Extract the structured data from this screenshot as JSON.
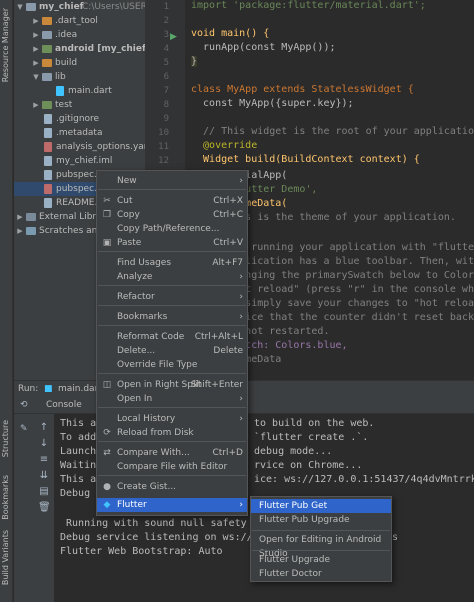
{
  "left_strip": {
    "tabs": [
      "Resource Manager",
      "Structure",
      "Bookmarks",
      "Build Variants"
    ]
  },
  "project_tree": {
    "items": [
      {
        "label": "my_chief",
        "sublabel": "C:\\Users\\USER-F",
        "kind": "folder"
      },
      {
        "label": ".dart_tool",
        "kind": "folder-orange"
      },
      {
        "label": ".idea",
        "kind": "folder"
      },
      {
        "label": "android [my_chief_andro",
        "kind": "folder-green"
      },
      {
        "label": "build",
        "kind": "folder-orange"
      },
      {
        "label": "lib",
        "kind": "folder"
      },
      {
        "label": "main.dart",
        "kind": "dart"
      },
      {
        "label": "test",
        "kind": "folder-green"
      },
      {
        "label": ".gitignore",
        "kind": "file"
      },
      {
        "label": ".metadata",
        "kind": "file"
      },
      {
        "label": "analysis_options.yaml",
        "kind": "yaml"
      },
      {
        "label": "my_chief.iml",
        "kind": "file"
      },
      {
        "label": "pubspec.lock",
        "kind": "file"
      },
      {
        "label": "pubspec.ya",
        "kind": "yaml"
      },
      {
        "label": "README.m",
        "kind": "file"
      },
      {
        "label": "External Librar",
        "kind": "lib"
      },
      {
        "label": "Scratches and",
        "kind": "scratch"
      }
    ]
  },
  "editor": {
    "line_numbers": [
      "1",
      "2",
      "3",
      "4",
      "5",
      "6",
      "7",
      "8",
      "9",
      "10",
      "11",
      "12"
    ],
    "lines": [
      {
        "n": "1",
        "text": "import 'package:flutter/material.dart';"
      },
      {
        "n": "3",
        "text": "void main() {"
      },
      {
        "n": "4",
        "text": "  runApp(const MyApp());"
      },
      {
        "n": "5",
        "text": "}"
      },
      {
        "n": "7",
        "text": "class MyApp extends StatelessWidget {"
      },
      {
        "n": "8",
        "text": "  const MyApp({super.key});"
      },
      {
        "n": "10",
        "text": "  // This widget is the root of your application."
      },
      {
        "n": "11",
        "text": "  @override"
      },
      {
        "n": "12",
        "text": "  Widget build(BuildContext context) {"
      },
      {
        "n": "",
        "text": "    MaterialApp("
      },
      {
        "n": "",
        "text": "    : 'Flutter Demo',"
      },
      {
        "n": "",
        "text": "    : ThemeData("
      },
      {
        "n": "",
        "text": "      This is the theme of your application."
      },
      {
        "n": "",
        "text": "      Try running your application with \"flutter"
      },
      {
        "n": "",
        "text": "      application has a blue toolbar. Then, with"
      },
      {
        "n": "",
        "text": "      changing the primarySwatch below to Colors"
      },
      {
        "n": "",
        "text": "      \"hot reload\" (press \"r\" in the console whe"
      },
      {
        "n": "",
        "text": "      or simply save your changes to \"hot reload"
      },
      {
        "n": "",
        "text": "      Notice that the counter didn't reset back"
      },
      {
        "n": "",
        "text": "      is not restarted."
      },
      {
        "n": "",
        "text": "    rySwatch: Colors.blue,"
      },
      {
        "n": "",
        "text": "    / ThemeData"
      }
    ]
  },
  "run_panel": {
    "run_label": "Run:",
    "run_tab": "main.dart",
    "console_tab": "Console",
    "console_lines": [
      "This a",
      "To add",
      "Launch",
      "Waitin",
      "This a",
      "Debug",
      "",
      " Running with sound null safety",
      "Debug service listening on ws://127",
      "Flutter Web Bootstrap: Auto"
    ],
    "console_right_lines": [
      "to build on the web.",
      "`flutter create .`.",
      "debug mode...",
      "rvice on Chrome...",
      "ice: ws://127.0.0.1:51437/4q4dvMntrrk=/ws",
      "",
      "",
      "",
      "s"
    ]
  },
  "context_menu": {
    "items": [
      {
        "label": "New",
        "key": "",
        "submenu": true,
        "icon": ""
      },
      {
        "sep": true
      },
      {
        "label": "Cut",
        "key": "Ctrl+X",
        "icon": "cut-icon"
      },
      {
        "label": "Copy",
        "key": "Ctrl+C",
        "icon": "copy-icon"
      },
      {
        "label": "Copy Path/Reference...",
        "key": ""
      },
      {
        "label": "Paste",
        "key": "Ctrl+V",
        "icon": "paste-icon"
      },
      {
        "sep": true
      },
      {
        "label": "Find Usages",
        "key": "Alt+F7"
      },
      {
        "label": "Analyze",
        "key": "",
        "submenu": true
      },
      {
        "sep": true
      },
      {
        "label": "Refactor",
        "key": "",
        "submenu": true
      },
      {
        "sep": true
      },
      {
        "label": "Bookmarks",
        "key": "",
        "submenu": true
      },
      {
        "sep": true
      },
      {
        "label": "Reformat Code",
        "key": "Ctrl+Alt+L"
      },
      {
        "label": "Delete...",
        "key": "Delete"
      },
      {
        "label": "Override File Type",
        "key": ""
      },
      {
        "sep": true
      },
      {
        "label": "Open in Right Split",
        "key": "Shift+Enter",
        "icon": "split-icon"
      },
      {
        "label": "Open In",
        "key": "",
        "submenu": true
      },
      {
        "sep": true
      },
      {
        "label": "Local History",
        "key": "",
        "submenu": true
      },
      {
        "label": "Reload from Disk",
        "key": "",
        "icon": "reload-icon"
      },
      {
        "sep": true
      },
      {
        "label": "Compare With...",
        "key": "Ctrl+D",
        "icon": "compare-icon"
      },
      {
        "label": "Compare File with Editor",
        "key": ""
      },
      {
        "sep": true
      },
      {
        "label": "Create Gist...",
        "key": "",
        "icon": "github-icon"
      },
      {
        "label": "Flutter",
        "key": "",
        "submenu": true,
        "highlighted": true,
        "icon": ""
      }
    ]
  },
  "flutter_submenu": {
    "items": [
      {
        "label": "Flutter Pub Get",
        "highlighted": true
      },
      {
        "label": "Flutter Pub Upgrade"
      },
      {
        "sep": true
      },
      {
        "label": "Open for Editing in Android Studio"
      },
      {
        "sep": true
      },
      {
        "label": "Flutter Upgrade"
      },
      {
        "label": "Flutter Doctor"
      }
    ]
  },
  "colors": {
    "accent": "#2f65ca",
    "panel": "#3c3f41",
    "editor_bg": "#2b2b2b"
  }
}
